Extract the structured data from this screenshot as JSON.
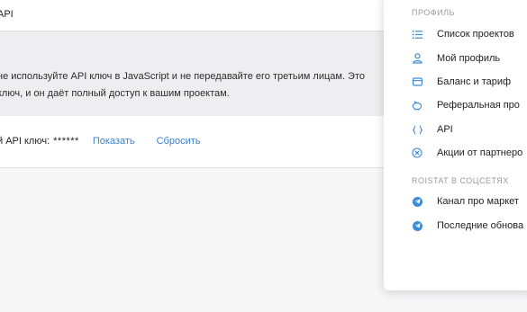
{
  "header": {
    "title": "API"
  },
  "notice": {
    "line1": "не используйте API ключ в JavaScript и не передавайте его третьим лицам. Это",
    "line2": "ключ, и он даёт полный доступ к вашим проектам."
  },
  "api_key": {
    "label": "й API ключ:",
    "masked_value": "******",
    "show_link": "Показать",
    "reset_link": "Сбросить"
  },
  "menu": {
    "profile_section": "ПРОФИЛЬ",
    "items": [
      {
        "label": "Список проектов",
        "icon": "list-icon"
      },
      {
        "label": "Мой профиль",
        "icon": "user-icon"
      },
      {
        "label": "Баланс и тариф",
        "icon": "wallet-icon"
      },
      {
        "label": "Реферальная про",
        "icon": "piggy-bank-icon"
      },
      {
        "label": "API",
        "icon": "code-braces-icon"
      },
      {
        "label": "Акции от партнеро",
        "icon": "badge-icon"
      }
    ],
    "social_section": "ROISTAT В СОЦСЕТЯХ",
    "social_items": [
      {
        "label": "Канал про маркет",
        "icon": "telegram-icon"
      },
      {
        "label": "Последние обнова",
        "icon": "telegram-icon"
      }
    ]
  },
  "colors": {
    "accent_link": "#3d7fc9",
    "icon_blue": "#3a8ad6",
    "telegram": "#3a8ad6"
  }
}
